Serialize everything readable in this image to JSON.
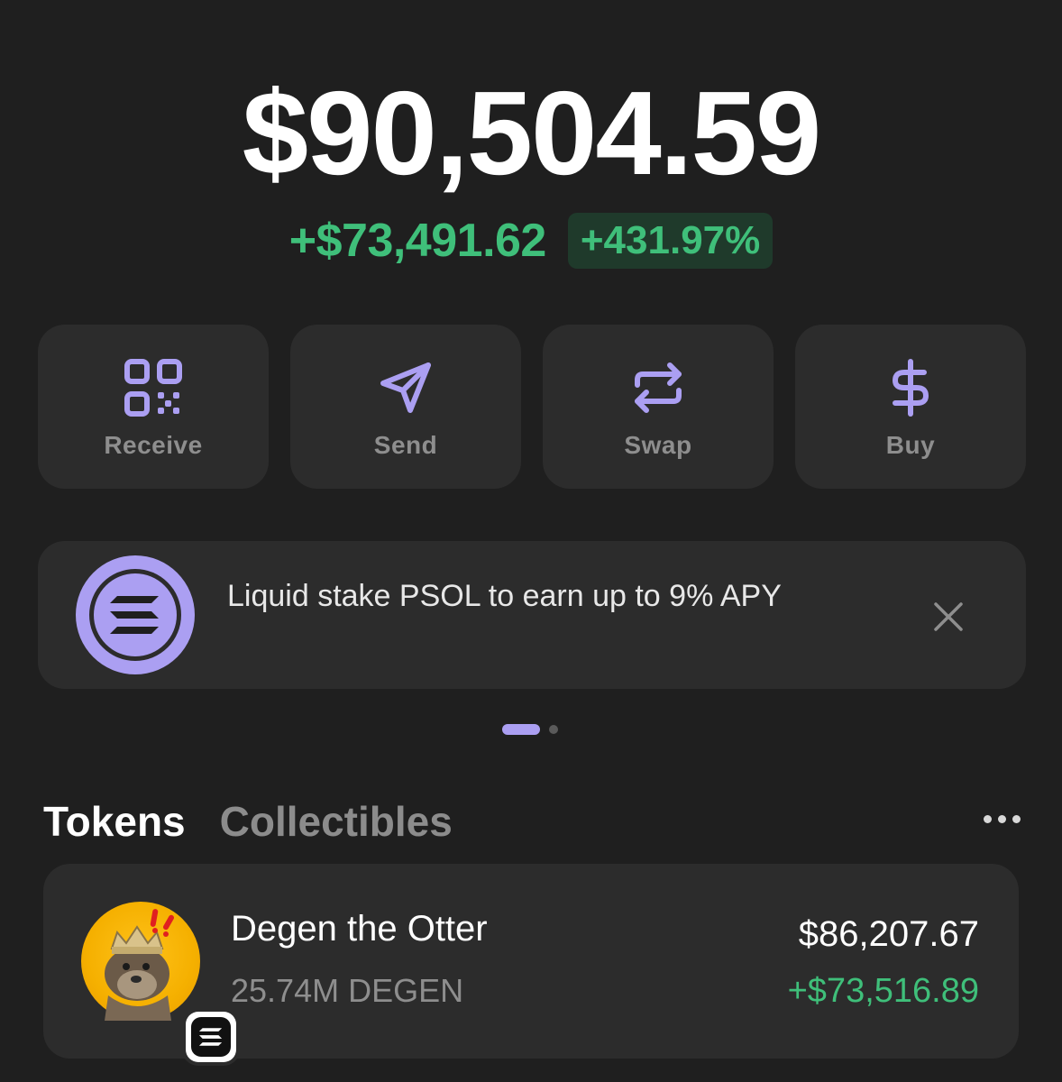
{
  "portfolio": {
    "balance": "$90,504.59",
    "change_amount": "+$73,491.62",
    "change_percent": "+431.97%"
  },
  "actions": [
    {
      "label": "Receive",
      "icon": "qr-code-icon"
    },
    {
      "label": "Send",
      "icon": "send-icon"
    },
    {
      "label": "Swap",
      "icon": "swap-icon"
    },
    {
      "label": "Buy",
      "icon": "dollar-icon"
    }
  ],
  "promo": {
    "text": "Liquid stake PSOL to earn up to 9% APY",
    "icon": "solana-logo-icon",
    "close_icon": "close-icon"
  },
  "pager": {
    "current": 1,
    "total": 2
  },
  "tabs": [
    {
      "label": "Tokens",
      "active": true
    },
    {
      "label": "Collectibles",
      "active": false
    }
  ],
  "tokens": [
    {
      "name": "Degen the Otter",
      "amount": "25.74M DEGEN",
      "value": "$86,207.67",
      "change": "+$73,516.89",
      "icon": "degen-otter-avatar",
      "chain_icon": "solana-badge-icon"
    }
  ],
  "colors": {
    "background": "#1f1f1f",
    "card": "#2c2c2c",
    "accent": "#ab9ff2",
    "positive": "#3fbf7a",
    "muted": "#8e8e8e"
  }
}
